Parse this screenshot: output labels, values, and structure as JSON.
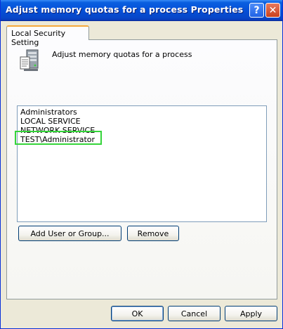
{
  "window": {
    "title": "Adjust memory quotas for a process Properties",
    "help_glyph": "?",
    "close_glyph": "✕"
  },
  "tabs": [
    {
      "label": "Local Security Setting",
      "selected": true
    }
  ],
  "policy": {
    "icon": "policy-server-icon",
    "name": "Adjust memory quotas for a process"
  },
  "accounts": {
    "items": [
      "Administrators",
      "LOCAL SERVICE",
      "NETWORK SERVICE",
      "TEST\\Administrator"
    ],
    "highlighted": "TEST\\Administrator",
    "highlight_color": "#35d43a"
  },
  "actions": {
    "add_label": "Add User or Group...",
    "remove_label": "Remove"
  },
  "footer": {
    "ok_label": "OK",
    "cancel_label": "Cancel",
    "apply_label": "Apply"
  },
  "colors": {
    "titlebar": "#0550d8",
    "dialog_bg": "#ece9d8",
    "tab_accent": "#f5a83c"
  }
}
